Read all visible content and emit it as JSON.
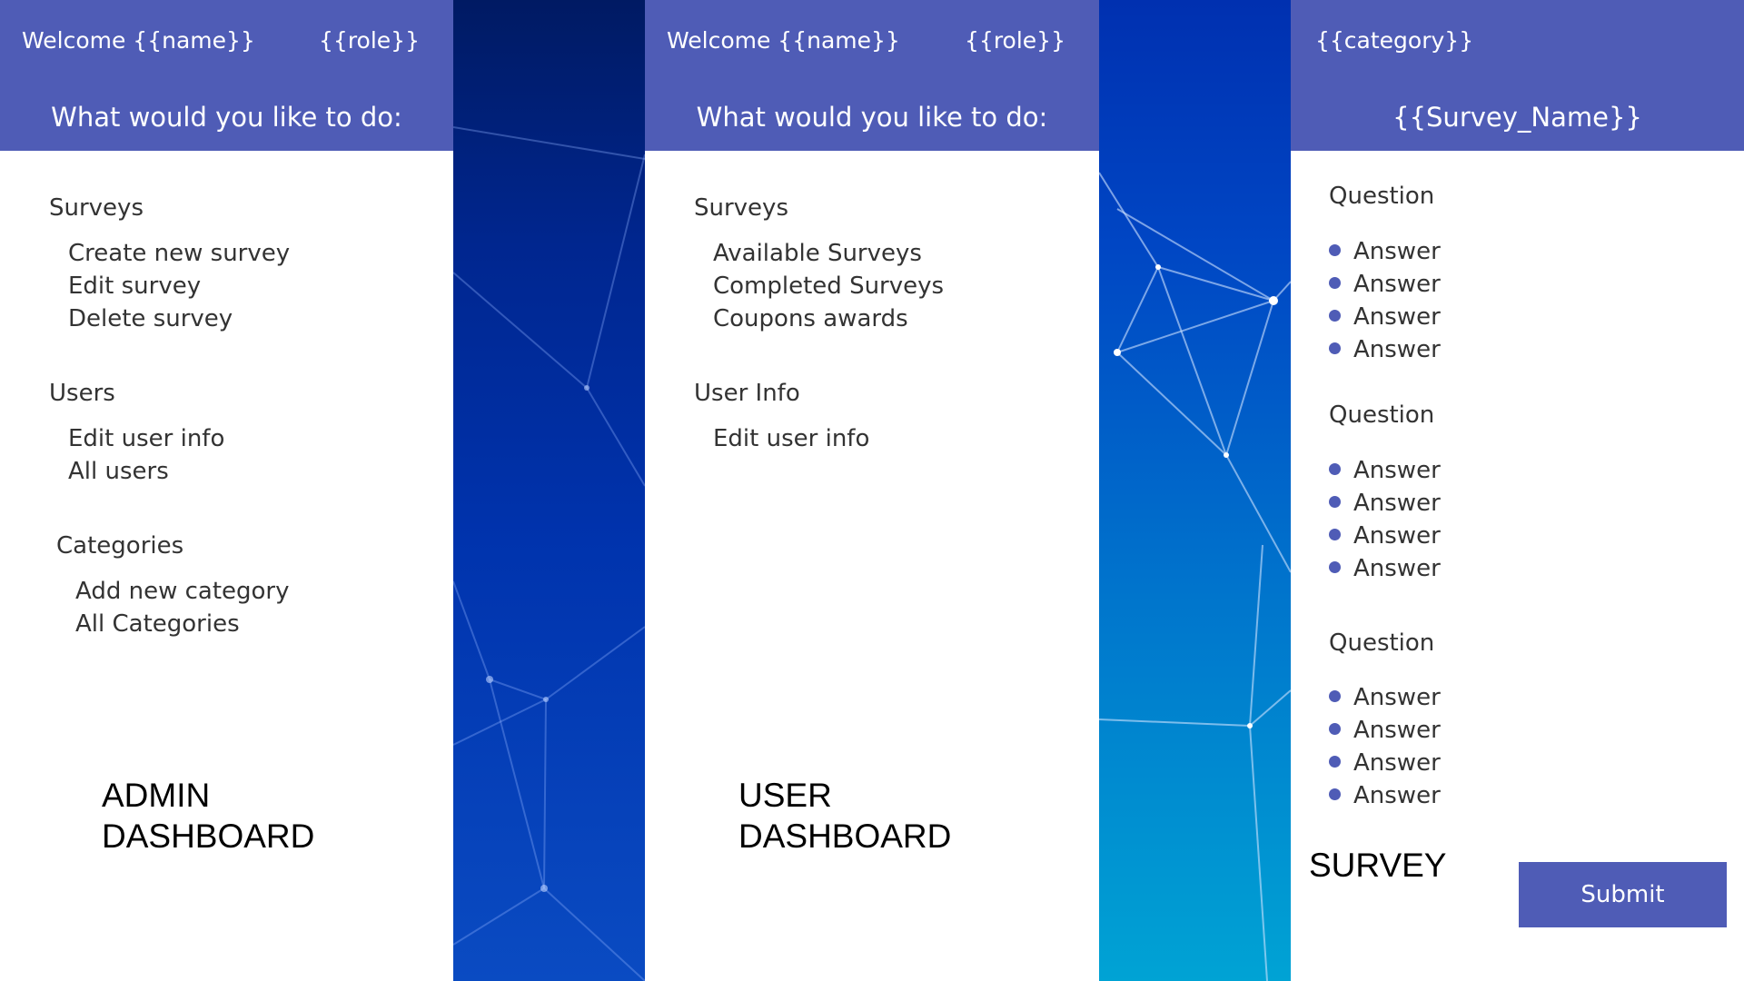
{
  "admin": {
    "welcome": "Welcome {{name}}",
    "role": "{{role}}",
    "prompt": "What would you like to do:",
    "sections": [
      {
        "title": "Surveys",
        "items": [
          "Create new survey",
          "Edit survey",
          "Delete survey"
        ]
      },
      {
        "title": "Users",
        "items": [
          "Edit user info",
          "All users"
        ]
      },
      {
        "title": "Categories",
        "items": [
          "Add new category",
          "All Categories"
        ]
      }
    ],
    "label_line1": "ADMIN",
    "label_line2": "DASHBOARD"
  },
  "user": {
    "welcome": "Welcome {{name}}",
    "role": "{{role}}",
    "prompt": "What would you like to do:",
    "sections": [
      {
        "title": "Surveys",
        "items": [
          "Available Surveys",
          "Completed Surveys",
          "Coupons awards"
        ]
      },
      {
        "title": "User Info",
        "items": [
          "Edit user info"
        ]
      }
    ],
    "label_line1": "USER",
    "label_line2": "DASHBOARD"
  },
  "survey": {
    "category": "{{category}}",
    "survey_name": "{{Survey_Name}}",
    "questions": [
      {
        "label": "Question",
        "answers": [
          "Answer",
          "Answer",
          "Answer",
          "Answer"
        ]
      },
      {
        "label": "Question",
        "answers": [
          "Answer",
          "Answer",
          "Answer",
          "Answer"
        ]
      },
      {
        "label": "Question",
        "answers": [
          "Answer",
          "Answer",
          "Answer",
          "Answer"
        ]
      }
    ],
    "label": "SURVEY",
    "submit_label": "Submit"
  },
  "colors": {
    "header": "#4f5cb6",
    "bullet": "#4f5cb6",
    "submit": "#4f5cb6"
  }
}
